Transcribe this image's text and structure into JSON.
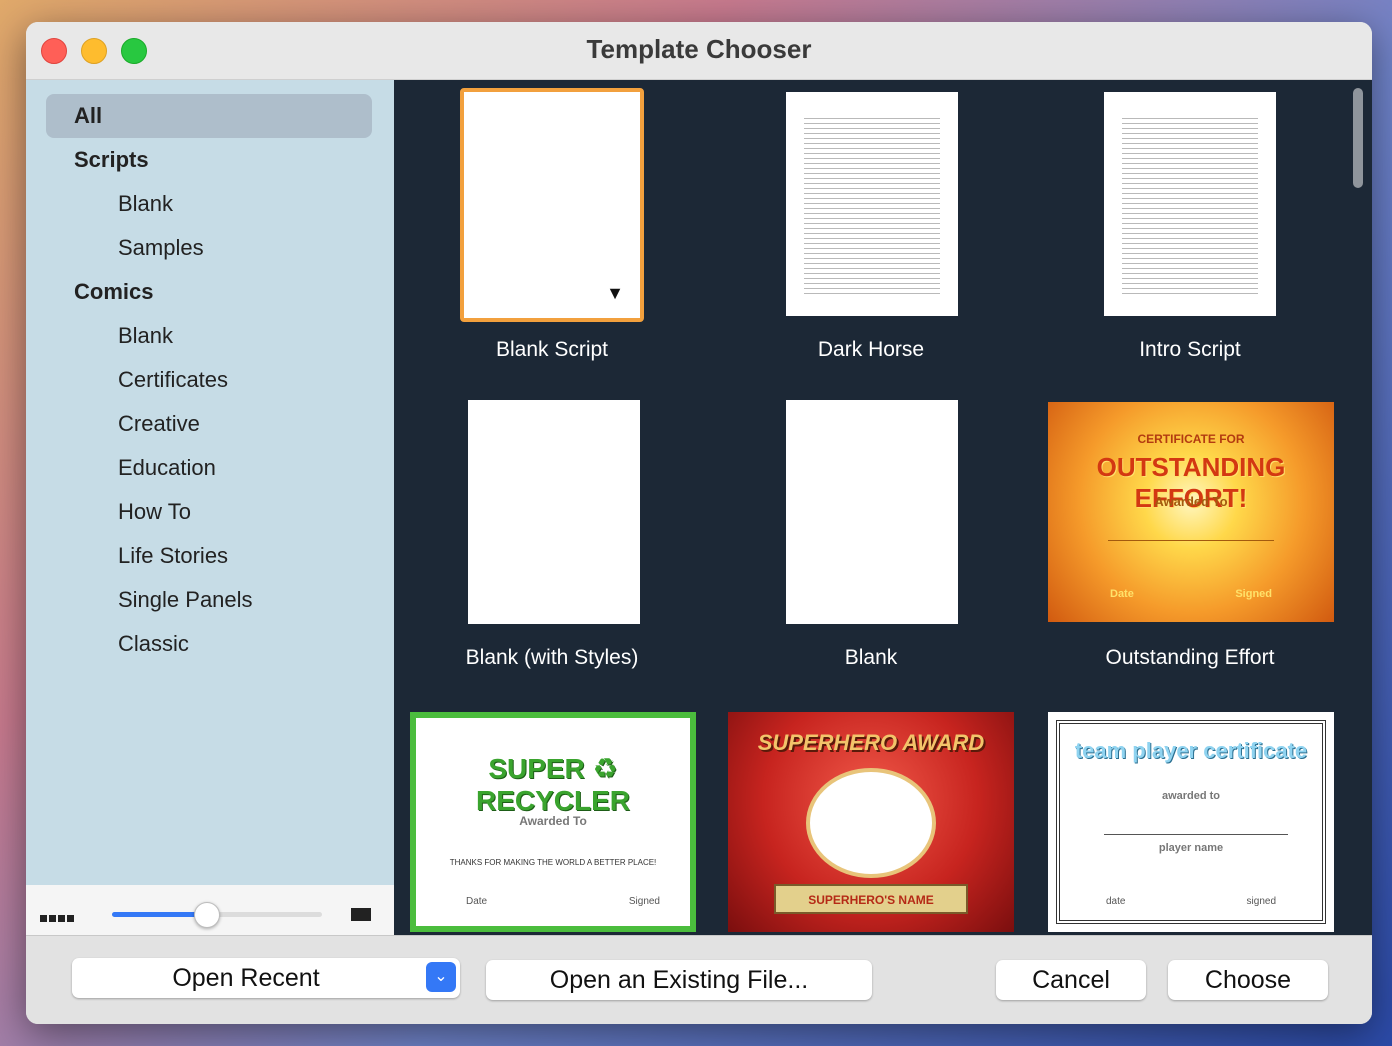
{
  "window": {
    "title": "Template Chooser"
  },
  "sidebar": {
    "items": [
      {
        "label": "All",
        "kind": "group",
        "selected": true
      },
      {
        "label": "Scripts",
        "kind": "group"
      },
      {
        "label": "Blank",
        "kind": "sub"
      },
      {
        "label": "Samples",
        "kind": "sub"
      },
      {
        "label": "Comics",
        "kind": "group"
      },
      {
        "label": "Blank",
        "kind": "sub"
      },
      {
        "label": "Certificates",
        "kind": "sub"
      },
      {
        "label": "Creative",
        "kind": "sub"
      },
      {
        "label": "Education",
        "kind": "sub"
      },
      {
        "label": "How To",
        "kind": "sub"
      },
      {
        "label": "Life Stories",
        "kind": "sub"
      },
      {
        "label": "Single Panels",
        "kind": "sub"
      },
      {
        "label": "Classic",
        "kind": "sub"
      }
    ],
    "zoom_slider": {
      "value": 0.45
    }
  },
  "templates": [
    {
      "label": "Blank Script"
    },
    {
      "label": "Dark Horse"
    },
    {
      "label": "Intro Script"
    },
    {
      "label": "Blank (with Styles)"
    },
    {
      "label": "Blank"
    },
    {
      "label": "Outstanding Effort"
    }
  ],
  "cert_art": {
    "outstanding": {
      "top": "CERTIFICATE FOR",
      "main": "OUTSTANDING EFFORT!",
      "sub": "Awarded To",
      "date": "Date",
      "signed": "Signed"
    },
    "recycler": {
      "main1": "SUPER",
      "main2": "RECYCLER",
      "sub": "Awarded To",
      "line": "THANKS FOR MAKING THE WORLD A BETTER PLACE!",
      "date": "Date",
      "signed": "Signed"
    },
    "superhero": {
      "main": "SUPERHERO AWARD",
      "name": "SUPERHERO'S NAME"
    },
    "teamplayer": {
      "main": "team player certificate",
      "sub": "awarded to",
      "name": "player name",
      "date": "date",
      "signed": "signed"
    }
  },
  "buttons": {
    "open_recent": "Open Recent",
    "open_existing": "Open an Existing File...",
    "cancel": "Cancel",
    "choose": "Choose"
  },
  "colors": {
    "accent": "#3478f6",
    "selection": "#f2a03d",
    "gallery_bg": "#1c2836",
    "sidebar_bg": "#c6dce6"
  }
}
